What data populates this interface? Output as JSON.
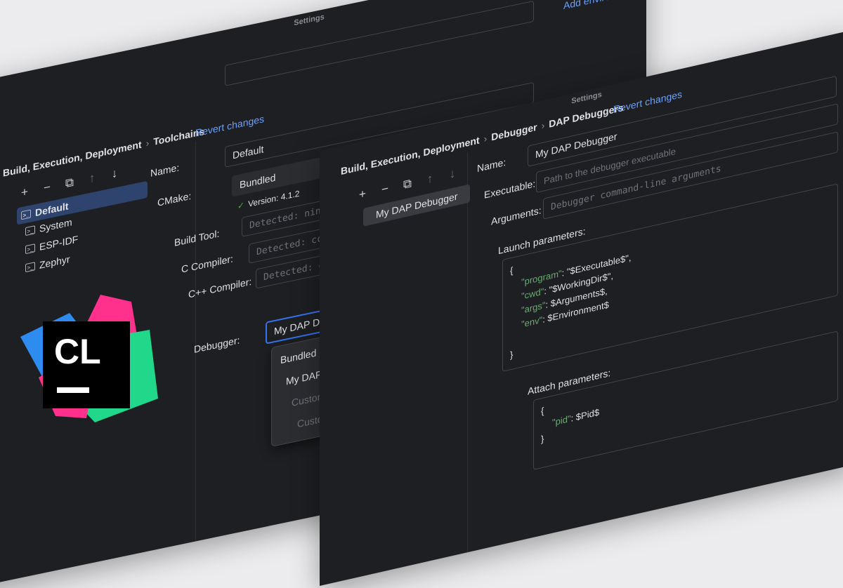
{
  "toolchains_window": {
    "title": "Settings",
    "breadcrumb": [
      "Build, Execution, Deployment",
      "Toolchains"
    ],
    "revert_label": "Revert changes",
    "add_environment_label": "Add environment",
    "toolbar": [
      "+",
      "−",
      "copy",
      "up",
      "down"
    ],
    "toolchains": [
      "Default",
      "System",
      "ESP-IDF",
      "Zephyr"
    ],
    "selected_toolchain": "Default",
    "name_label": "Name:",
    "name_value": "Default",
    "cmake_label": "CMake:",
    "cmake_value": "Bundled",
    "cmake_version": "Version: 4.1.2",
    "build_tool_label": "Build Tool:",
    "build_tool_placeholder": "Detected: ninja",
    "c_compiler_label": "C Compiler:",
    "c_compiler_placeholder": "Detected: cc",
    "cpp_compiler_label": "C++ Compiler:",
    "cpp_compiler_placeholder": "Detected: c++",
    "debugger_label": "Debugger:",
    "debugger_value": "My DAP Debugger",
    "debugger_options": [
      "Bundled LLDB",
      "My DAP Debugger",
      "Custom GDB executa",
      "Custom LLDB execut"
    ]
  },
  "dap_window": {
    "title": "Settings",
    "breadcrumb": [
      "Build, Execution, Deployment",
      "Debugger",
      "DAP Debuggers"
    ],
    "revert_label": "Revert changes",
    "toolbar": [
      "+",
      "−",
      "copy",
      "up",
      "down"
    ],
    "debuggers": [
      "My DAP Debugger"
    ],
    "name_label": "Name:",
    "name_value": "My DAP Debugger",
    "executable_label": "Executable:",
    "executable_placeholder": "Path to the debugger executable",
    "arguments_label": "Arguments:",
    "arguments_placeholder": "Debugger command-line arguments",
    "launch_label": "Launch parameters:",
    "launch_lines": [
      {
        "key": "",
        "text": "{"
      },
      {
        "key": "\"program\"",
        "text": ": \"$Executable$\","
      },
      {
        "key": "\"cwd\"",
        "text": ": \"$WorkingDir$\","
      },
      {
        "key": "\"args\"",
        "text": ": $Arguments$,"
      },
      {
        "key": "\"env\"",
        "text": ": $Environment$"
      },
      {
        "key": "",
        "text": ""
      },
      {
        "key": "",
        "text": "}"
      }
    ],
    "attach_label": "Attach parameters:",
    "attach_lines": [
      {
        "key": "",
        "text": "{"
      },
      {
        "key": "\"pid\"",
        "text": ": $Pid$"
      },
      {
        "key": "",
        "text": "}"
      }
    ]
  },
  "logo": {
    "text": "CL"
  },
  "colors": {
    "accent": "#3574f0",
    "link": "#6aa1ff",
    "bg": "#1e1f22",
    "json_key": "#6aab73"
  },
  "nav_icons": [
    "arrow-left-icon",
    "arrow-right-icon"
  ]
}
